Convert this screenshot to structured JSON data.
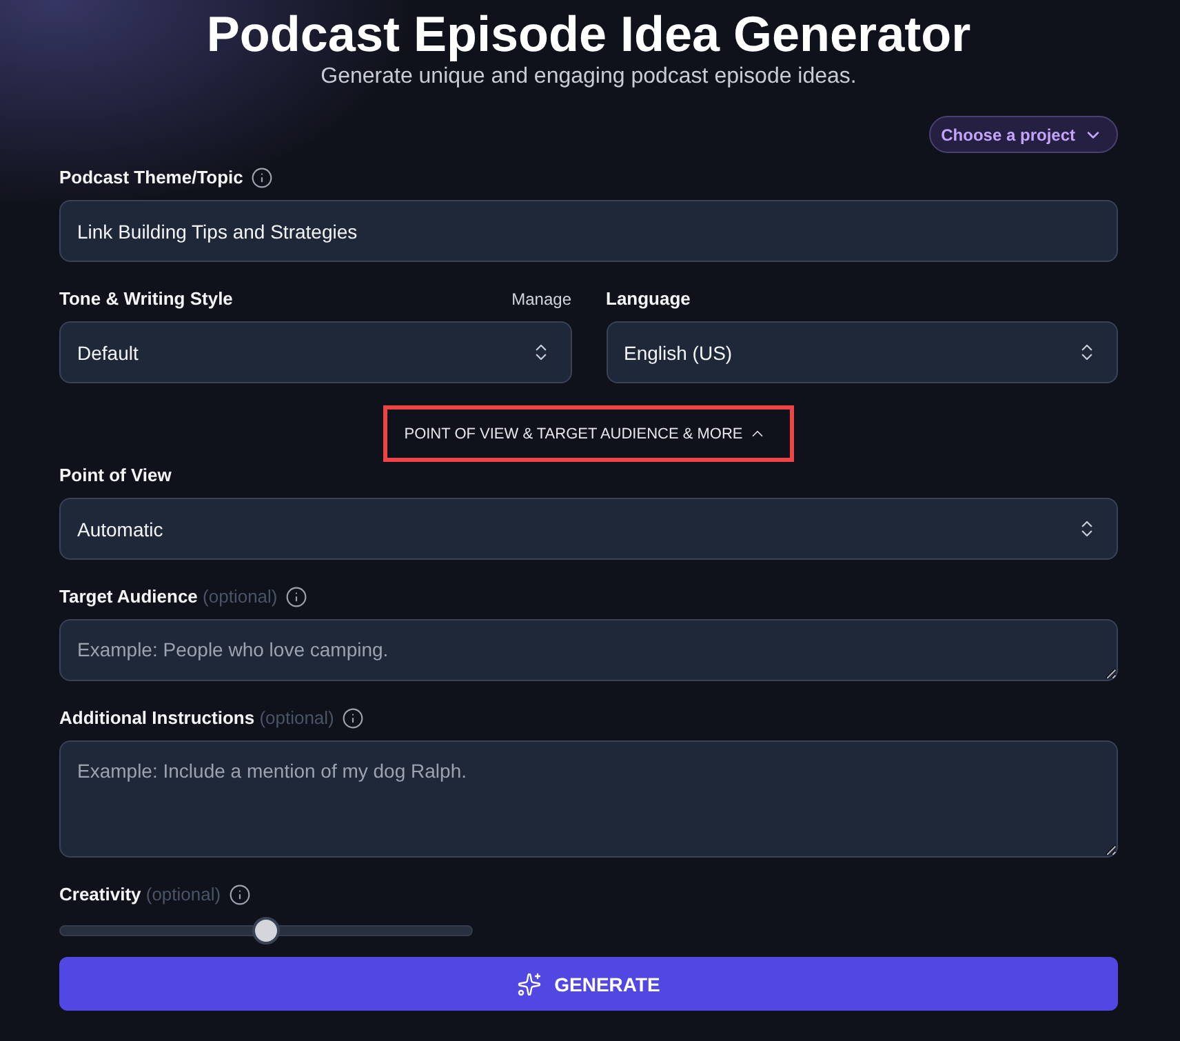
{
  "header": {
    "title": "Podcast Episode Idea Generator",
    "subtitle": "Generate unique and engaging podcast episode ideas."
  },
  "project_menu": {
    "label": "Choose a project"
  },
  "theme": {
    "label": "Podcast Theme/Topic",
    "info": true,
    "value": "Link Building Tips and Strategies"
  },
  "tone": {
    "label": "Tone & Writing Style",
    "info": false,
    "action": "Manage",
    "value": "Default"
  },
  "language": {
    "label": "Language",
    "info": false,
    "value": "English (US)"
  },
  "more_toggle": {
    "label": "POINT OF VIEW & TARGET AUDIENCE & MORE",
    "expanded": true,
    "highlighted": true
  },
  "point_of_view": {
    "label": "Point of View",
    "info": false,
    "value": "Automatic"
  },
  "target_audience": {
    "label": "Target Audience",
    "optional": "(optional)",
    "info": true,
    "placeholder": "Example: People who love camping."
  },
  "additional_instructions": {
    "label": "Additional Instructions",
    "optional": "(optional)",
    "info": true,
    "placeholder": "Example: Include a mention of my dog Ralph."
  },
  "creativity": {
    "label": "Creativity",
    "optional": "(optional)",
    "info": true,
    "level": 0.5
  },
  "generate_button": {
    "label": "GENERATE"
  }
}
